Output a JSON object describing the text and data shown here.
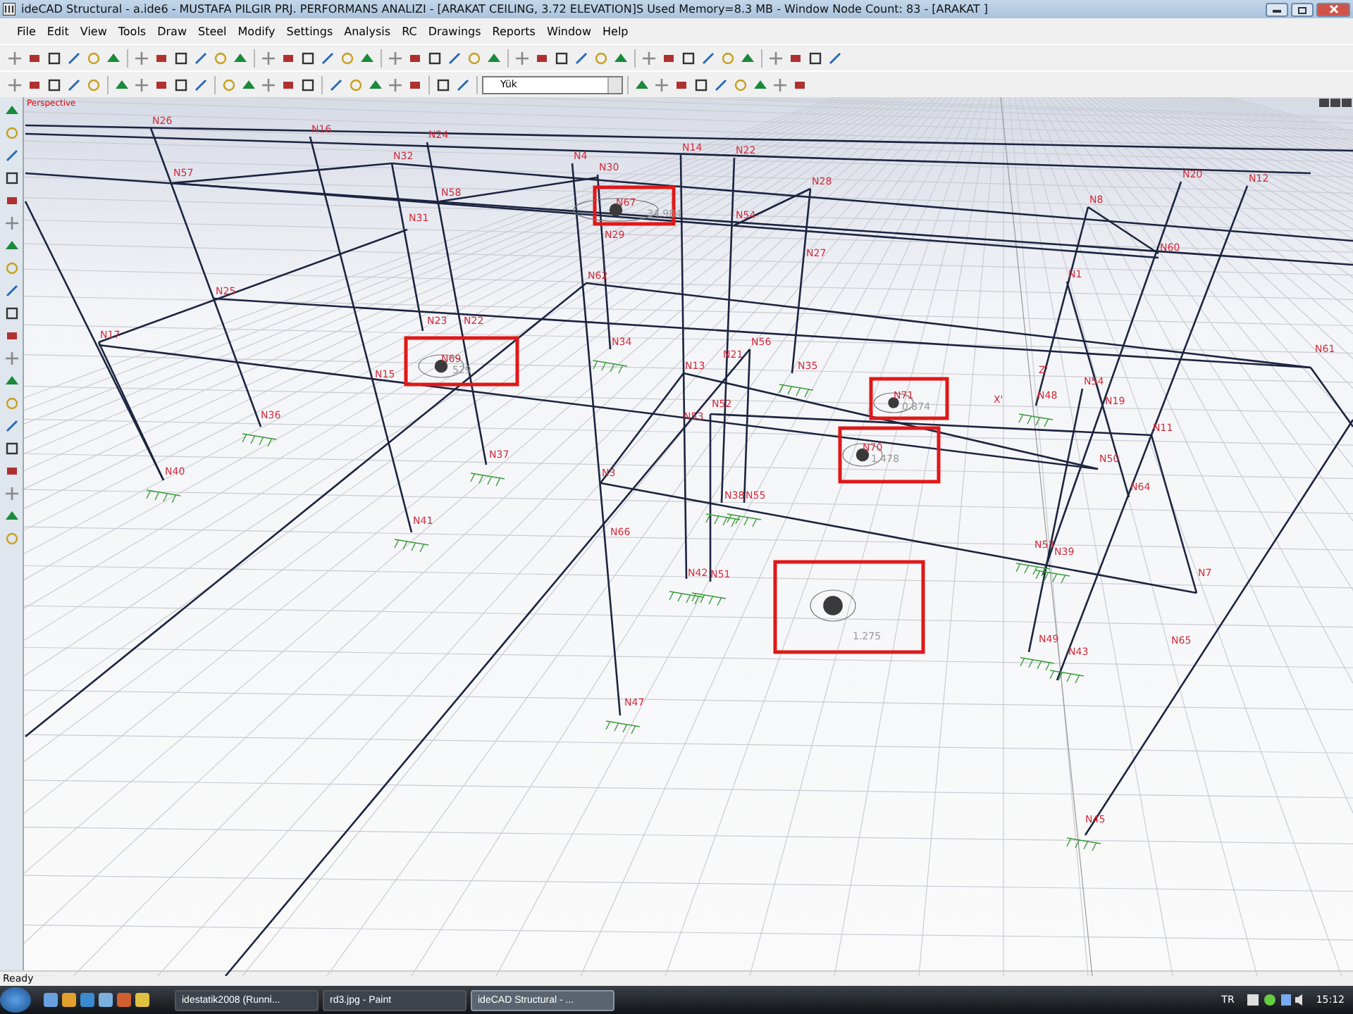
{
  "window": {
    "title": "ideCAD Structural - a.ide6 - MUSTAFA PILGIR PRJ. PERFORMANS ANALIZI - [ARAKAT CEILING,  3.72 ELEVATION]S Used Memory=8.3 MB - Window Node Count: 83 - [ARAKAT ]"
  },
  "menu": [
    "File",
    "Edit",
    "View",
    "Tools",
    "Draw",
    "Steel",
    "Modify",
    "Settings",
    "Analysis",
    "RC",
    "Drawings",
    "Reports",
    "Window",
    "Help"
  ],
  "toolbar": {
    "layer_combo": "Yük"
  },
  "viewport": {
    "label": "Perspective",
    "nodes": [
      "N26",
      "N16",
      "N24",
      "N32",
      "N57",
      "N4",
      "N30",
      "N14",
      "N22",
      "N58",
      "N28",
      "N20",
      "N12",
      "N8",
      "N54",
      "N29",
      "N31",
      "N60",
      "N27",
      "N62",
      "N1",
      "N25",
      "N17",
      "N23",
      "N22",
      "N34",
      "N56",
      "N21",
      "N13",
      "N35",
      "N61",
      "N48",
      "N54",
      "N19",
      "N15",
      "N52",
      "N53",
      "N11",
      "N50",
      "N36",
      "N37",
      "N40",
      "N3",
      "N64",
      "N38",
      "N55",
      "N66",
      "N41",
      "N53",
      "N39",
      "N42",
      "N51",
      "N7",
      "N49",
      "N43",
      "N65",
      "N47",
      "N45"
    ],
    "axes": [
      "Z'",
      "X'"
    ],
    "load_markers": [
      {
        "label": "N67",
        "value": "34.984"
      },
      {
        "label": "N69",
        "value": "529"
      },
      {
        "label": "N71",
        "value": "0.874"
      },
      {
        "label": "N70",
        "value": "1.478"
      },
      {
        "value": "1.275"
      }
    ]
  },
  "status_bar": "Ready",
  "taskbar": {
    "tasks": [
      {
        "label": "idestatik2008 (Runni...",
        "selected": false
      },
      {
        "label": "rd3.jpg - Paint",
        "selected": false
      },
      {
        "label": "ideCAD Structural - ...",
        "selected": true
      }
    ],
    "language": "TR",
    "clock": "15:12"
  }
}
